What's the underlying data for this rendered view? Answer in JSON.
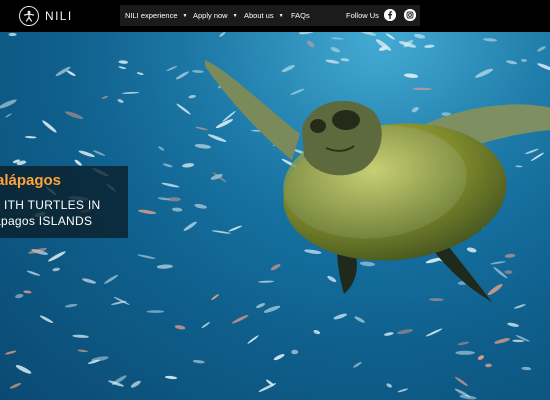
{
  "brand": {
    "name": "NILI",
    "logo_icon": "person-in-circle-icon"
  },
  "nav": {
    "items": [
      {
        "label": "NILI experience",
        "has_dropdown": true
      },
      {
        "label": "Apply now",
        "has_dropdown": true
      },
      {
        "label": "About us",
        "has_dropdown": true
      },
      {
        "label": "FAQs",
        "has_dropdown": false
      }
    ],
    "follow_label": "Follow Us",
    "social": [
      {
        "name": "facebook-icon",
        "glyph": "f"
      },
      {
        "name": "instagram-icon",
        "glyph": "◎"
      }
    ]
  },
  "hero": {
    "caption": {
      "line1": "alápagos",
      "line2": "ITH TURTLES IN",
      "line3": "ápagos ISLANDS"
    }
  },
  "colors": {
    "header_bg": "#000000",
    "nav_bg": "#1b1b1b",
    "caption_accent": "#ffa33a",
    "ocean": "#1677a8"
  }
}
